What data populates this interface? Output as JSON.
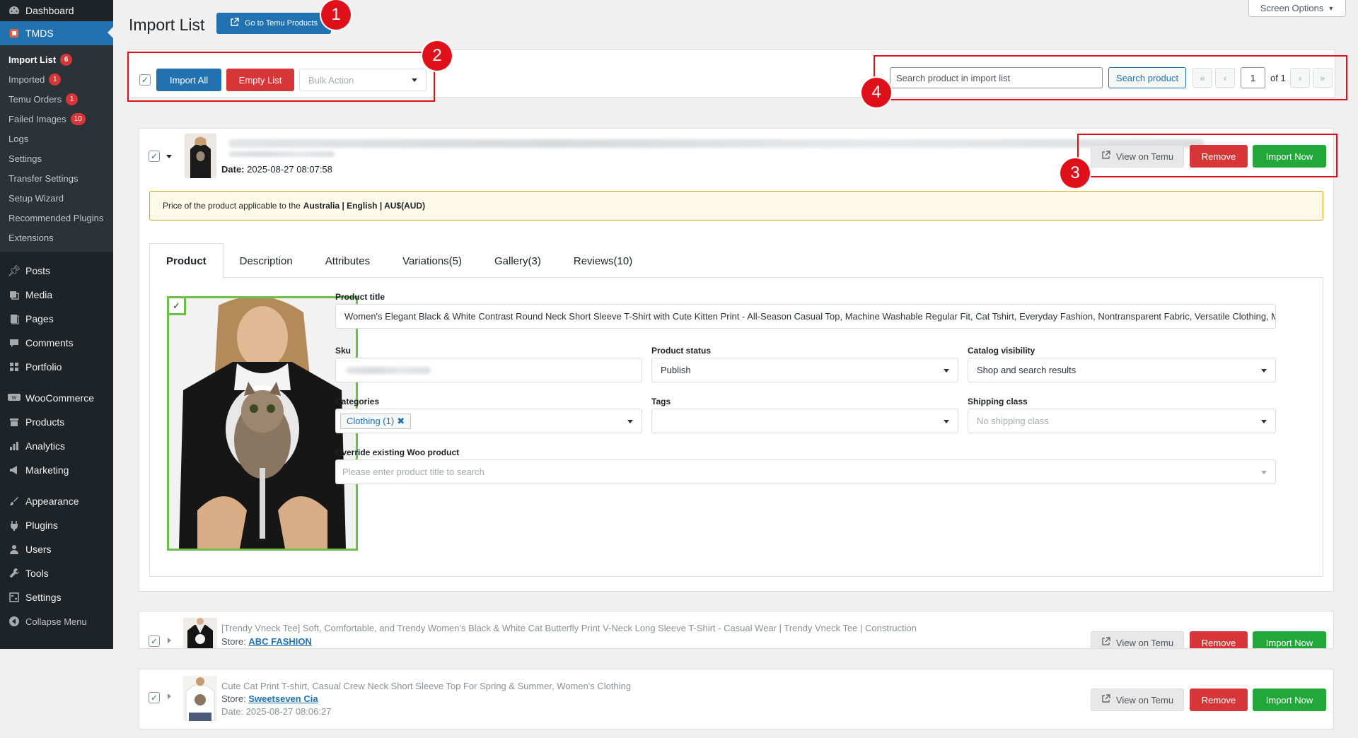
{
  "sidebar": {
    "top": [
      {
        "label": "Dashboard",
        "icon": "dashboard-icon"
      },
      {
        "label": "TMDS",
        "icon": "temu-icon"
      }
    ],
    "submenu": [
      {
        "label": "Import List",
        "badge": "6"
      },
      {
        "label": "Imported",
        "badge": "1"
      },
      {
        "label": "Temu Orders",
        "badge": "1"
      },
      {
        "label": "Failed Images",
        "badge": "10"
      },
      {
        "label": "Logs"
      },
      {
        "label": "Settings"
      },
      {
        "label": "Transfer Settings"
      },
      {
        "label": "Setup Wizard"
      },
      {
        "label": "Recommended Plugins"
      },
      {
        "label": "Extensions"
      }
    ],
    "group1": [
      {
        "label": "Posts",
        "icon": "pin-icon"
      },
      {
        "label": "Media",
        "icon": "media-icon"
      },
      {
        "label": "Pages",
        "icon": "page-icon"
      },
      {
        "label": "Comments",
        "icon": "comment-icon"
      },
      {
        "label": "Portfolio",
        "icon": "grid-icon"
      }
    ],
    "group2": [
      {
        "label": "WooCommerce",
        "icon": "woo-icon"
      },
      {
        "label": "Products",
        "icon": "archive-icon"
      },
      {
        "label": "Analytics",
        "icon": "bar-chart-icon"
      },
      {
        "label": "Marketing",
        "icon": "megaphone-icon"
      }
    ],
    "group3": [
      {
        "label": "Appearance",
        "icon": "brush-icon"
      },
      {
        "label": "Plugins",
        "icon": "plugin-icon"
      },
      {
        "label": "Users",
        "icon": "user-icon"
      },
      {
        "label": "Tools",
        "icon": "wrench-icon"
      },
      {
        "label": "Settings",
        "icon": "settings-icon"
      },
      {
        "label": "Collapse Menu",
        "icon": "collapse-icon"
      }
    ]
  },
  "header": {
    "title": "Import List",
    "go_button": "Go to Temu Products",
    "screen_options": "Screen Options"
  },
  "toolbar": {
    "import_all": "Import All",
    "empty_list": "Empty List",
    "bulk_action": "Bulk Action",
    "search_placeholder": "Search product in import list",
    "search_button": "Search product",
    "page_current": "1",
    "page_total": "of 1",
    "first": "«",
    "prev": "‹",
    "next": "›",
    "last": "»"
  },
  "annotations": [
    "1",
    "2",
    "3",
    "4"
  ],
  "product1": {
    "date_label": "Date:",
    "date_value": "2025-08-27 08:07:58",
    "view_button": "View on Temu",
    "remove_button": "Remove",
    "import_button": "Import Now",
    "notice_prefix": "Price of the product applicable to the",
    "notice_bold": "Australia | English | AU$(AUD)",
    "tabs": [
      "Product",
      "Description",
      "Attributes",
      "Variations(5)",
      "Gallery(3)",
      "Reviews(10)"
    ],
    "fields": {
      "title_label": "Product title",
      "title_value": "Women's Elegant Black & White Contrast Round Neck Short Sleeve T-Shirt with Cute Kitten Print - All-Season Casual Top, Machine Washable Regular Fit, Cat Tshirt, Everyday Fashion, Nontransparent Fabric, Versatile Clothing, Min",
      "sku_label": "Sku",
      "status_label": "Product status",
      "status_value": "Publish",
      "visibility_label": "Catalog visibility",
      "visibility_value": "Shop and search results",
      "categories_label": "Categories",
      "category_chip": "Clothing (1)",
      "tags_label": "Tags",
      "shipping_label": "Shipping class",
      "shipping_placeholder": "No shipping class",
      "override_label": "Override existing Woo product",
      "override_placeholder": "Please enter product title to search"
    }
  },
  "product2": {
    "title": "[Trendy Vneck Tee] Soft, Comfortable, and Trendy Women's Black & White Cat Butterfly Print V-Neck Long Sleeve T-Shirt - Casual Wear | Trendy Vneck Tee | Construction",
    "store_label": "Store:",
    "store_name": "ABC FASHION",
    "view_button": "View on Temu",
    "remove_button": "Remove",
    "import_button": "Import Now"
  },
  "product3": {
    "title": "Cute Cat Print T-shirt, Casual Crew Neck Short Sleeve Top For Spring & Summer, Women's Clothing",
    "store_label": "Store:",
    "store_name": "Sweetseven Cia",
    "date_label": "Date:",
    "date_value": "2025-08-27 08:06:27",
    "view_button": "View on Temu",
    "remove_button": "Remove",
    "import_button": "Import Now"
  },
  "colors": {
    "primary": "#2271b1",
    "danger": "#d63638",
    "success": "#22a83a",
    "annotation": "#e0101a",
    "sidebar": "#1d2327"
  }
}
